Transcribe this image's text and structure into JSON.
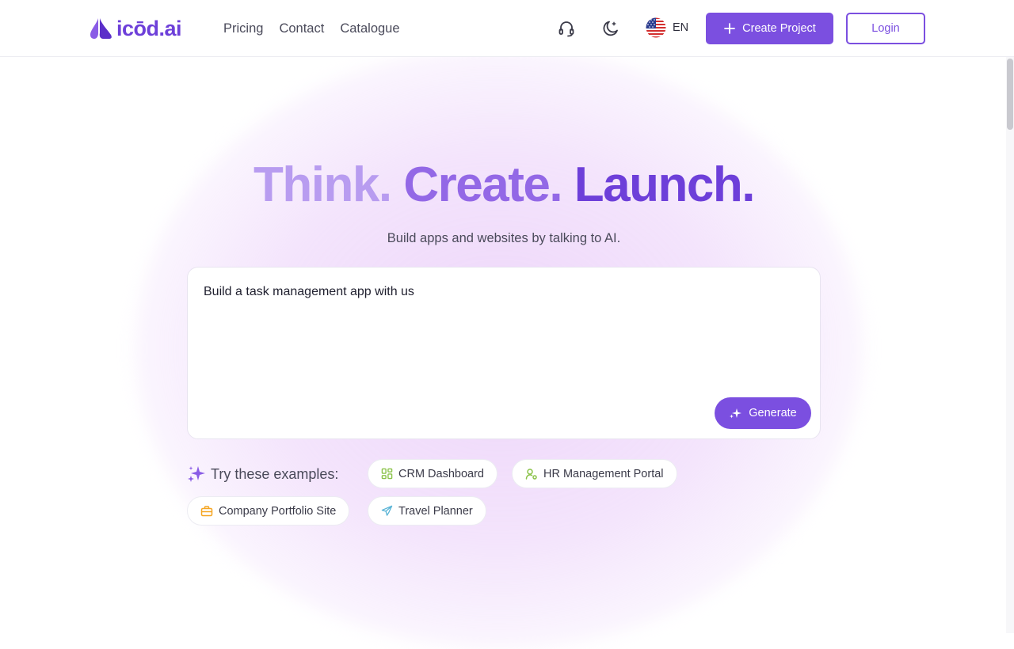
{
  "header": {
    "brand": "icōd.ai",
    "nav": [
      "Pricing",
      "Contact",
      "Catalogue"
    ],
    "icons": [
      "headset-icon",
      "moon-icon",
      "us-flag-icon"
    ],
    "language": "EN",
    "create_label": "Create Project",
    "login_label": "Login"
  },
  "hero": {
    "headline": [
      "Think.",
      "Create.",
      "Launch."
    ],
    "subtitle": "Build apps and websites by talking to AI.",
    "prompt_value": "Build a task management app with us",
    "generate_label": "Generate"
  },
  "examples": {
    "label": "Try these examples:",
    "items": [
      {
        "label": "CRM Dashboard",
        "icon": "grid-icon",
        "color": "#8bc34a"
      },
      {
        "label": "HR Management Portal",
        "icon": "user-gear-icon",
        "color": "#8bc34a"
      },
      {
        "label": "Company Portfolio Site",
        "icon": "briefcase-icon",
        "color": "#f5a623"
      },
      {
        "label": "Travel Planner",
        "icon": "plane-icon",
        "color": "#5ab4d6"
      }
    ]
  },
  "colors": {
    "primary": "#7b4fe0",
    "headline_1": "#b89cf0",
    "headline_2": "#9368e6",
    "headline_3": "#6d3fd9"
  }
}
